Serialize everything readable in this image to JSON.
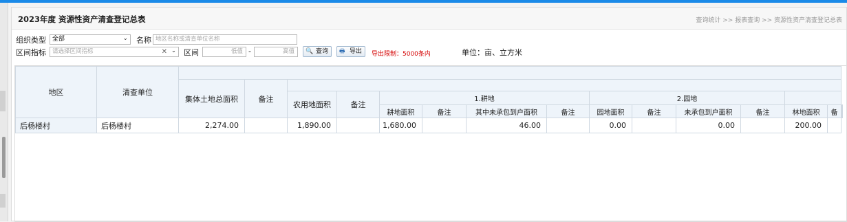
{
  "page": {
    "title": "2023年度 资源性资产清查登记总表",
    "breadcrumb": "查询统计 >> 报表查询 >> 资源性资产清查登记总表"
  },
  "filters": {
    "org_type_label": "组织类型",
    "org_type_value": "全部",
    "name_label": "名称",
    "name_placeholder": "地区名称或清查单位名称",
    "range_indicator_label": "区间指标",
    "range_indicator_placeholder": "请选择区间指标",
    "range_label": "区间",
    "range_low_placeholder": "低值",
    "range_sep": "-",
    "range_high_placeholder": "高值",
    "query_button": "查询",
    "export_button": "导出",
    "export_limit": "导出限制：5000条内",
    "unit_note": "单位：亩、立方米"
  },
  "table": {
    "headers": {
      "region": "地区",
      "unit": "清查单位",
      "collective_total": "集体土地总面积",
      "remark": "备注",
      "agri_area": "农用地面积",
      "farmland_group": "1.耕地",
      "farmland_area": "耕地面积",
      "farmland_contracted": "其中未承包到户面积",
      "garden_group": "2.园地",
      "garden_area": "园地面积",
      "garden_uncontracted": "未承包到户面积",
      "forest_area": "林地面积",
      "forest_remark": "备"
    },
    "rows": [
      {
        "region": "后杨楼村",
        "unit": "后杨楼村",
        "collective_total": "2,274.00",
        "collective_remark": "",
        "agri_area": "1,890.00",
        "agri_remark": "",
        "farmland_area": "1,680.00",
        "farmland_remark": "",
        "farmland_contracted": "46.00",
        "farmland_contracted_remark": "",
        "garden_area": "0.00",
        "garden_remark": "",
        "garden_uncontracted": "0.00",
        "garden_uncontracted_remark": "",
        "forest_area": "200.00"
      }
    ]
  }
}
